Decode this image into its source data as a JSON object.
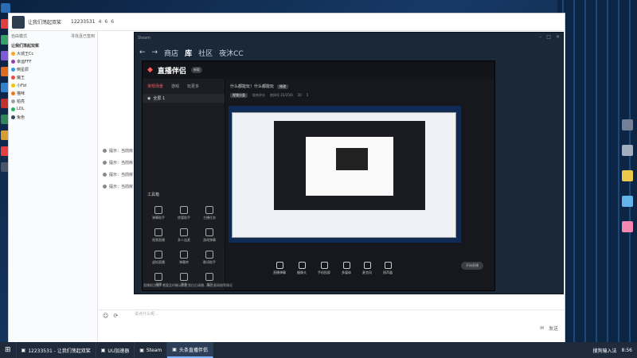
{
  "qq": {
    "group_name": "让我们荡起双桨",
    "group_number": "12233531",
    "header_icons": [
      "4",
      "6",
      "6"
    ],
    "left_header": "自由模式",
    "left_header_right": "寻找且已签到",
    "members_title": "让我们荡起双桨",
    "members": [
      {
        "name": "大城王Cc",
        "color": "#f5a623"
      },
      {
        "name": "幸运FFF",
        "color": "#8e44ad"
      },
      {
        "name": "倒星辰",
        "color": "#3498db"
      },
      {
        "name": "魔王",
        "color": "#e74c3c"
      },
      {
        "name": "小Fid",
        "color": "#f1c40f"
      },
      {
        "name": "猫咪",
        "color": "#e67e22"
      },
      {
        "name": "柏亮",
        "color": "#95a5a6"
      },
      {
        "name": "LOL",
        "color": "#27ae60"
      },
      {
        "name": "兔色",
        "color": "#34495e"
      }
    ],
    "sys_msgs": [
      "提示：当前房",
      "提示：当前房",
      "提示：当前房",
      "提示：当前房"
    ],
    "input_placeholder": "说点什么呢...",
    "send_label": "发送"
  },
  "steam": {
    "app_name": "Steam",
    "nav": [
      "商店",
      "库",
      "社区",
      "夜沐CC"
    ]
  },
  "app": {
    "logo": "直播伴侣",
    "version": "新版",
    "tabs": [
      "常规场景",
      "游戏",
      "玩更多"
    ],
    "scene_label": "全屏 1",
    "title": "什么都能玩！什么都能玩",
    "title_tag": "修改",
    "stats": [
      "视频分类",
      "综合评分",
      "房间号 25/25/0",
      "20",
      "5"
    ],
    "tools_title": "工具箱",
    "tools": [
      "弹幕助手",
      "房管助手",
      "主播任务",
      "视频直播",
      "多人连麦",
      "游戏弹幕",
      "虚拟直播",
      "弹幕库",
      "歌词助手",
      "开播",
      "更多",
      "关于"
    ],
    "controls": [
      "直播弹幕",
      "摄像头",
      "手机投屏",
      "多媒体",
      "麦克风",
      "扬声器"
    ],
    "start_label": "开始直播",
    "tip": "直播前注意，需要及时确认分区到位后请播、请注意网络等情况"
  },
  "taskbar": {
    "tasks": [
      {
        "label": "12233531 - 让我们荡起双桨",
        "active": false
      },
      {
        "label": "UU加速器",
        "active": false
      },
      {
        "label": "Steam",
        "active": false
      },
      {
        "label": "头条直播伴侣",
        "active": true
      }
    ],
    "tray_text": "搜狗输入法",
    "time": "8:56"
  },
  "colors": {
    "accent": "#1e88e5",
    "brand_red": "#ff5a5a"
  }
}
